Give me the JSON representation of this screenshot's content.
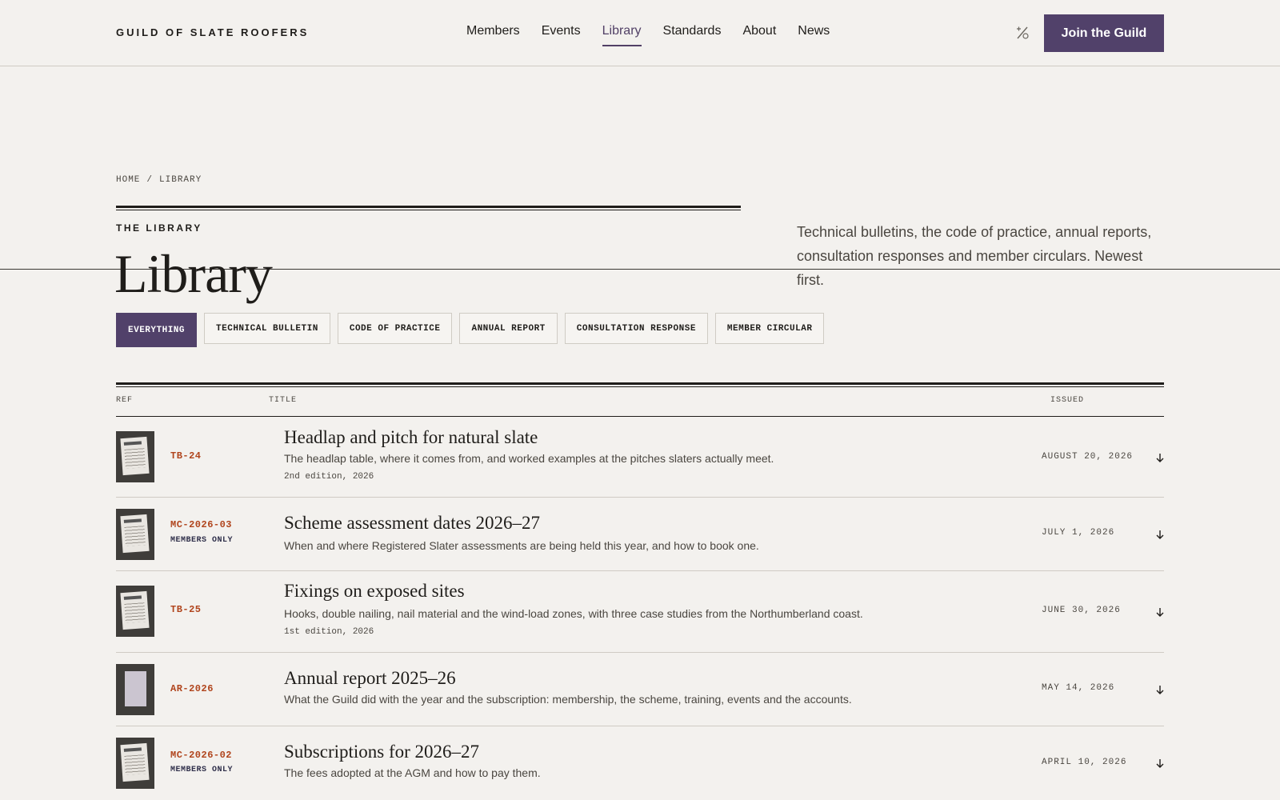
{
  "header": {
    "brand": "GUILD OF SLATE ROOFERS",
    "nav": [
      {
        "label": "Members"
      },
      {
        "label": "Events"
      },
      {
        "label": "Library"
      },
      {
        "label": "Standards"
      },
      {
        "label": "About"
      },
      {
        "label": "News"
      }
    ],
    "active_nav": "Library",
    "theme_toggle_icon": "contrast-toggle-icon",
    "join_label": "Join the Guild"
  },
  "breadcrumb": [
    "HOME",
    "LIBRARY"
  ],
  "hero": {
    "eyebrow": "THE LIBRARY",
    "title": "Library",
    "intro": "Technical bulletins, the code of practice, annual reports, consultation responses and member circulars. Newest first."
  },
  "filters": [
    {
      "label": "EVERYTHING",
      "active": true
    },
    {
      "label": "TECHNICAL BULLETIN",
      "active": false
    },
    {
      "label": "CODE OF PRACTICE",
      "active": false
    },
    {
      "label": "ANNUAL REPORT",
      "active": false
    },
    {
      "label": "CONSULTATION RESPONSE",
      "active": false
    },
    {
      "label": "MEMBER CIRCULAR",
      "active": false
    }
  ],
  "table": {
    "columns": {
      "ref": "REF",
      "title": "TITLE",
      "issued": "ISSUED"
    },
    "rows": [
      {
        "ref": "TB-24",
        "members_only": "",
        "title": "Headlap and pitch for natural slate",
        "description": "The headlap table, where it comes from, and worked examples at the pitches slaters actually meet.",
        "edition": "2nd edition, 2026",
        "issued": "AUGUST 20, 2026"
      },
      {
        "ref": "MC-2026-03",
        "members_only": "MEMBERS ONLY",
        "title": "Scheme assessment dates 2026–27",
        "description": "When and where Registered Slater assessments are being held this year, and how to book one.",
        "edition": "",
        "issued": "JULY 1, 2026"
      },
      {
        "ref": "TB-25",
        "members_only": "",
        "title": "Fixings on exposed sites",
        "description": "Hooks, double nailing, nail material and the wind-load zones, with three case studies from the Northumberland coast.",
        "edition": "1st edition, 2026",
        "issued": "JUNE 30, 2026"
      },
      {
        "ref": "AR-2026",
        "members_only": "",
        "title": "Annual report 2025–26",
        "description": "What the Guild did with the year and the subscription: membership, the scheme, training, events and the accounts.",
        "edition": "",
        "issued": "MAY 14, 2026"
      },
      {
        "ref": "MC-2026-02",
        "members_only": "MEMBERS ONLY",
        "title": "Subscriptions for 2026–27",
        "description": "The fees adopted at the AGM and how to pay them.",
        "edition": "",
        "issued": "APRIL 10, 2026"
      }
    ]
  },
  "colors": {
    "accent": "#51416a",
    "ref": "#b0441c",
    "background": "#f3f1ee"
  }
}
